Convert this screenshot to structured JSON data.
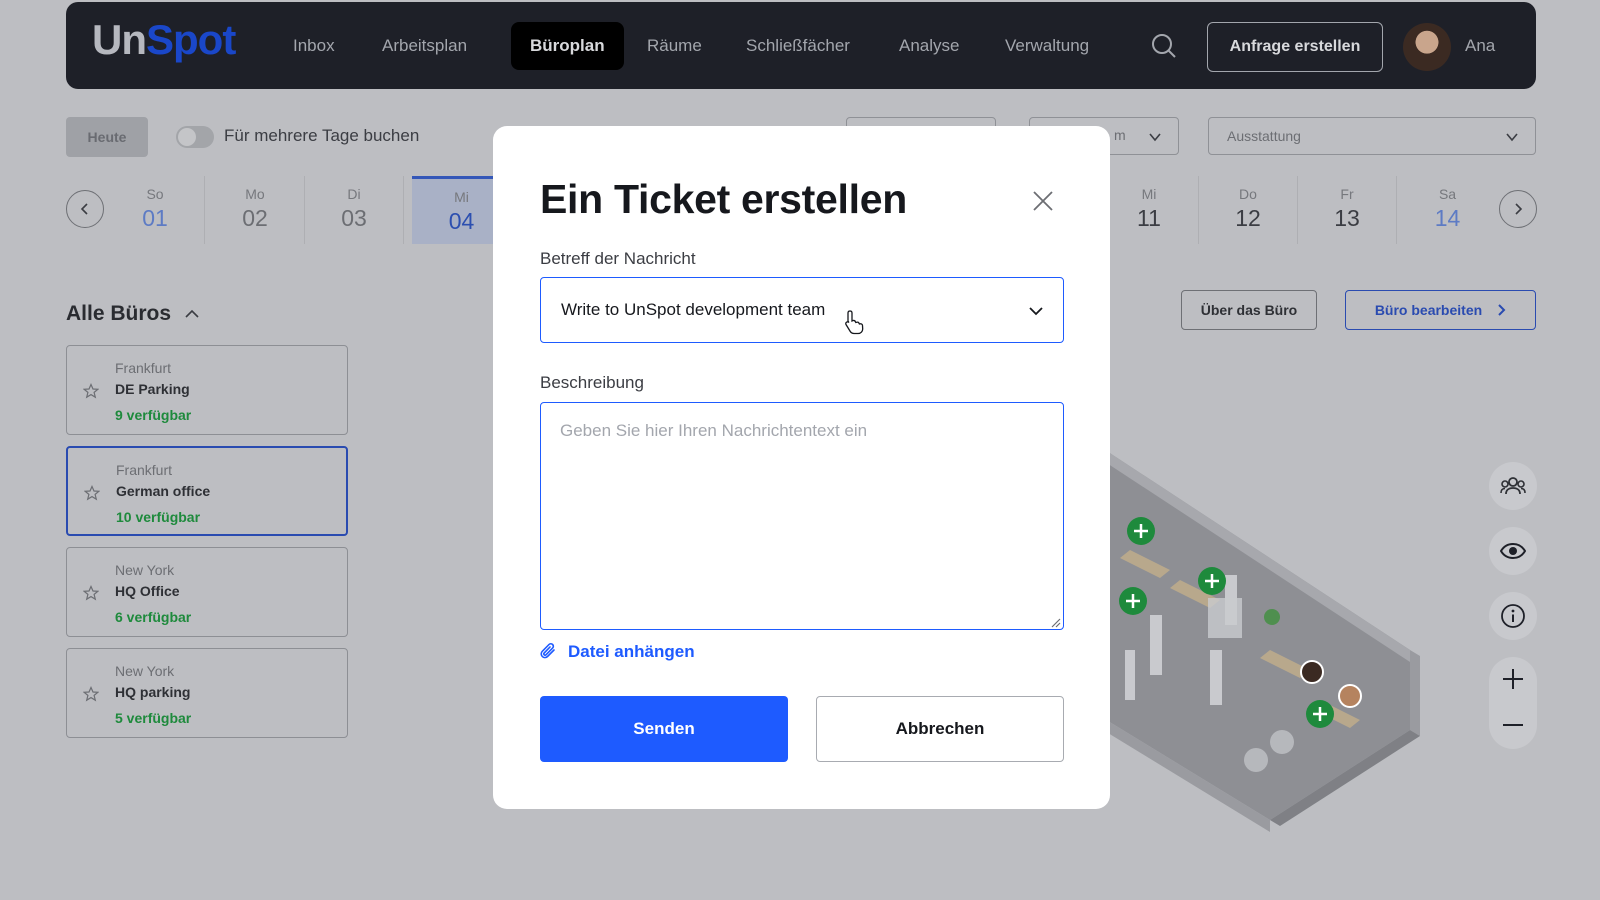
{
  "app": {
    "logo_part1": "Un",
    "logo_part2": "Spot"
  },
  "nav": {
    "items": [
      {
        "label": "Inbox"
      },
      {
        "label": "Arbeitsplan"
      },
      {
        "label": "Büroplan"
      },
      {
        "label": "Räume"
      },
      {
        "label": "Schließfächer"
      },
      {
        "label": "Analyse"
      },
      {
        "label": "Verwaltung"
      }
    ],
    "cta_label": "Anfrage erstellen",
    "user_name": "Ana"
  },
  "toolbar": {
    "today_label": "Heute",
    "multi_day_label": "Für mehrere Tage buchen",
    "filter2_partial": "m",
    "equipment_label": "Ausstattung"
  },
  "dates": [
    {
      "dow": "So",
      "num": "01"
    },
    {
      "dow": "Mo",
      "num": "02"
    },
    {
      "dow": "Di",
      "num": "03"
    },
    {
      "dow": "Mi",
      "num": "04"
    },
    {
      "dow": "Mi",
      "num": "11"
    },
    {
      "dow": "Do",
      "num": "12"
    },
    {
      "dow": "Fr",
      "num": "13"
    },
    {
      "dow": "Sa",
      "num": "14"
    }
  ],
  "offices": {
    "title": "Alle Büros",
    "items": [
      {
        "city": "Frankfurt",
        "name": "DE Parking",
        "available": "9 verfügbar"
      },
      {
        "city": "Frankfurt",
        "name": "German office",
        "available": "10 verfügbar"
      },
      {
        "city": "New York",
        "name": "HQ Office",
        "available": "6 verfügbar"
      },
      {
        "city": "New York",
        "name": "HQ parking",
        "available": "5 verfügbar"
      }
    ]
  },
  "office_actions": {
    "about_label": "Über das Büro",
    "edit_label": "Büro bearbeiten"
  },
  "modal": {
    "title": "Ein Ticket erstellen",
    "subject_label": "Betreff der Nachricht",
    "subject_value": "Write to UnSpot development team",
    "description_label": "Beschreibung",
    "description_placeholder": "Geben Sie hier Ihren Nachrichtentext ein",
    "attach_label": "Datei anhängen",
    "send_label": "Senden",
    "cancel_label": "Abbrechen"
  },
  "colors": {
    "nav_bg": "#1e2028",
    "primary": "#1e5bff",
    "available_green": "#1e8a3c",
    "overlay": "#bdbec2"
  }
}
